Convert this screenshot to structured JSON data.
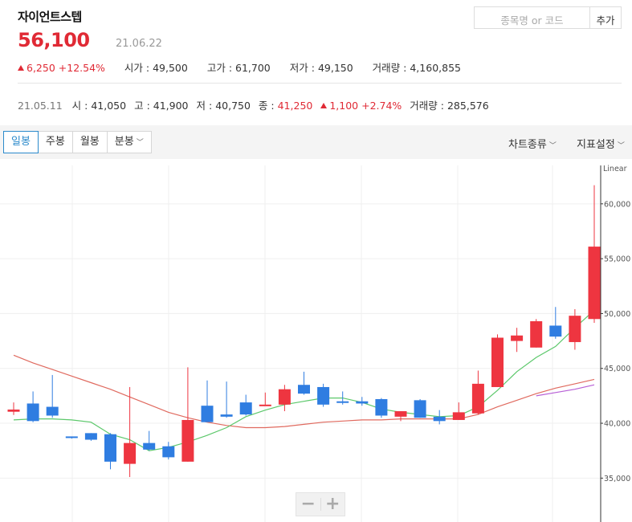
{
  "stock": {
    "name": "자이언트스텝",
    "price": "56,100",
    "date": "21.06.22",
    "change": "6,250",
    "change_pct": "+12.54%",
    "open_label": "시가",
    "open": "49,500",
    "high_label": "고가",
    "high": "61,700",
    "low_label": "저가",
    "low": "49,150",
    "volume_label": "거래량",
    "volume": "4,160,855"
  },
  "search": {
    "placeholder": "종목명 or 코드",
    "add_label": "추가"
  },
  "history": {
    "date": "21.05.11",
    "open_label": "시",
    "open": "41,050",
    "high_label": "고",
    "high": "41,900",
    "low_label": "저",
    "low": "40,750",
    "close_label": "종",
    "close": "41,250",
    "change": "1,100",
    "change_pct": "+2.74%",
    "volume_label": "거래량",
    "volume": "285,576"
  },
  "toolbar": {
    "tabs": [
      "일봉",
      "주봉",
      "월봉",
      "분봉"
    ],
    "active_tab": "일봉",
    "chart_type_label": "차트종류",
    "indicator_label": "지표설정"
  },
  "colors": {
    "up": "#ee3540",
    "down": "#2f7de1",
    "ma5": "#5cc86b",
    "ma20": "#e06a5f",
    "ma60": "#b75fd6"
  },
  "chart_data": {
    "type": "candlestick",
    "scale_label": "Linear",
    "ylim": [
      31000,
      63500
    ],
    "yticks": [
      35000,
      40000,
      45000,
      50000,
      55000,
      60000
    ],
    "ytick_labels": [
      "35,000",
      "40,000",
      "45,000",
      "50,000",
      "55,000",
      "60,000"
    ],
    "candles": [
      {
        "o": 41050,
        "h": 41900,
        "l": 40750,
        "c": 41250
      },
      {
        "o": 41800,
        "h": 42900,
        "l": 40100,
        "c": 40200
      },
      {
        "o": 41500,
        "h": 44400,
        "l": 40500,
        "c": 40700
      },
      {
        "o": 38800,
        "h": 38800,
        "l": 38600,
        "c": 38700
      },
      {
        "o": 39100,
        "h": 39100,
        "l": 38400,
        "c": 38500
      },
      {
        "o": 39000,
        "h": 39100,
        "l": 35800,
        "c": 36500
      },
      {
        "o": 36300,
        "h": 43300,
        "l": 35100,
        "c": 38200
      },
      {
        "o": 38200,
        "h": 39300,
        "l": 37500,
        "c": 37600
      },
      {
        "o": 37900,
        "h": 38300,
        "l": 36700,
        "c": 36900
      },
      {
        "o": 36500,
        "h": 45100,
        "l": 36500,
        "c": 40300
      },
      {
        "o": 41600,
        "h": 43900,
        "l": 40100,
        "c": 40100
      },
      {
        "o": 40800,
        "h": 43800,
        "l": 40500,
        "c": 40600
      },
      {
        "o": 41900,
        "h": 42600,
        "l": 40700,
        "c": 40800
      },
      {
        "o": 41700,
        "h": 42800,
        "l": 41600,
        "c": 41700
      },
      {
        "o": 41700,
        "h": 43500,
        "l": 41100,
        "c": 43100
      },
      {
        "o": 43500,
        "h": 44700,
        "l": 42600,
        "c": 42700
      },
      {
        "o": 43300,
        "h": 43600,
        "l": 41500,
        "c": 41700
      },
      {
        "o": 42000,
        "h": 42900,
        "l": 41700,
        "c": 41900
      },
      {
        "o": 42000,
        "h": 42400,
        "l": 41600,
        "c": 41800
      },
      {
        "o": 42200,
        "h": 42300,
        "l": 40500,
        "c": 40700
      },
      {
        "o": 40600,
        "h": 41100,
        "l": 40200,
        "c": 41100
      },
      {
        "o": 42100,
        "h": 42200,
        "l": 40500,
        "c": 40500
      },
      {
        "o": 40600,
        "h": 41200,
        "l": 39900,
        "c": 40200
      },
      {
        "o": 40300,
        "h": 41900,
        "l": 40300,
        "c": 41000
      },
      {
        "o": 40900,
        "h": 44800,
        "l": 40800,
        "c": 43600
      },
      {
        "o": 43300,
        "h": 48100,
        "l": 43300,
        "c": 47800
      },
      {
        "o": 47500,
        "h": 48700,
        "l": 46500,
        "c": 48000
      },
      {
        "o": 46900,
        "h": 49500,
        "l": 46900,
        "c": 49300
      },
      {
        "o": 48900,
        "h": 50600,
        "l": 47700,
        "c": 47900
      },
      {
        "o": 47400,
        "h": 50400,
        "l": 46700,
        "c": 49800
      },
      {
        "o": 49500,
        "h": 61700,
        "l": 49150,
        "c": 56100
      }
    ],
    "ma5": [
      40300,
      40400,
      40400,
      40300,
      40100,
      39000,
      38500,
      37500,
      37800,
      38300,
      38900,
      39600,
      40600,
      41200,
      41700,
      42000,
      42300,
      42300,
      41900,
      41300,
      41000,
      40800,
      40600,
      40700,
      41500,
      43000,
      44700,
      46000,
      47000,
      48700,
      50300
    ],
    "ma20": [
      46200,
      45500,
      44900,
      44300,
      43700,
      43100,
      42400,
      41700,
      41000,
      40500,
      40100,
      39800,
      39600,
      39600,
      39700,
      39900,
      40100,
      40200,
      40300,
      40300,
      40400,
      40400,
      40400,
      40400,
      40800,
      41500,
      42100,
      42700,
      43200,
      43600,
      44000
    ],
    "ma60": [
      null,
      null,
      null,
      null,
      null,
      null,
      null,
      null,
      null,
      null,
      null,
      null,
      null,
      null,
      null,
      null,
      null,
      null,
      null,
      null,
      null,
      null,
      null,
      null,
      null,
      null,
      null,
      42500,
      42800,
      43100,
      43500
    ]
  }
}
